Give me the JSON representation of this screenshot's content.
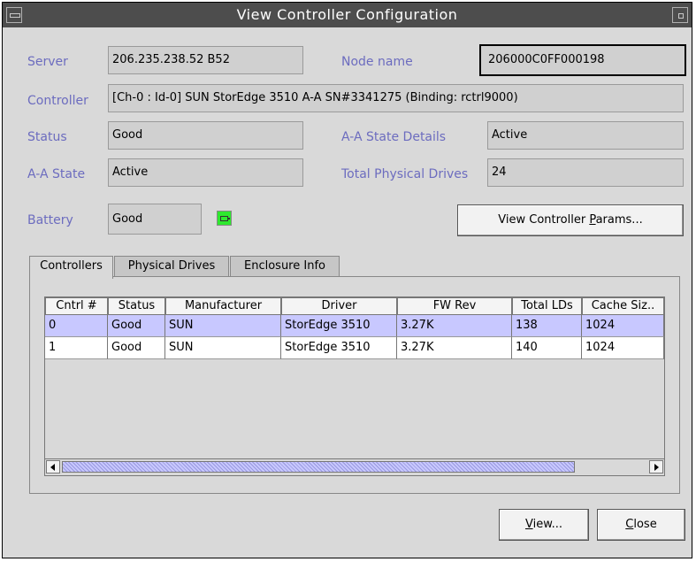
{
  "window": {
    "title": "View Controller Configuration"
  },
  "labels": {
    "server": "Server",
    "node_name": "Node name",
    "controller": "Controller",
    "status": "Status",
    "aa_state_details": "A-A State Details",
    "aa_state": "A-A State",
    "total_physical_drives": "Total Physical Drives",
    "battery": "Battery"
  },
  "values": {
    "server": "206.235.238.52 B52",
    "node_name": "206000C0FF000198",
    "controller": "[Ch-0 : Id-0] SUN StorEdge 3510 A-A SN#3341275  (Binding: rctrl9000)",
    "status": "Good",
    "aa_state_details": "Active",
    "aa_state": "Active",
    "total_physical_drives": "24",
    "battery": "Good"
  },
  "buttons": {
    "params_pre": "View Controller ",
    "params_mnemonic": "P",
    "params_post": "arams...",
    "view_mnemonic": "V",
    "view_post": "iew...",
    "close_mnemonic": "C",
    "close_post": "lose"
  },
  "tabs": [
    {
      "label": "Controllers",
      "active": true
    },
    {
      "label": "Physical Drives",
      "active": false
    },
    {
      "label": "Enclosure Info",
      "active": false
    }
  ],
  "table": {
    "columns": [
      "Cntrl #",
      "Status",
      "Manufacturer",
      "Driver",
      "FW Rev",
      "Total LDs",
      "Cache Siz.."
    ],
    "rows": [
      [
        "0",
        "Good",
        "SUN",
        "StorEdge 3510",
        "3.27K",
        "138",
        "1024"
      ],
      [
        "1",
        "Good",
        "SUN",
        "StorEdge 3510",
        "3.27K",
        "140",
        "1024"
      ]
    ],
    "selected_row": 0
  },
  "colors": {
    "label": "#6c6cbf",
    "selection": "#c8c8ff",
    "titlebar": "#4d4d4d",
    "battery_ok": "#2ee82e"
  },
  "icons": [
    "window-menu-icon",
    "window-iconify-icon",
    "battery-icon",
    "scroll-left-icon",
    "scroll-right-icon"
  ]
}
